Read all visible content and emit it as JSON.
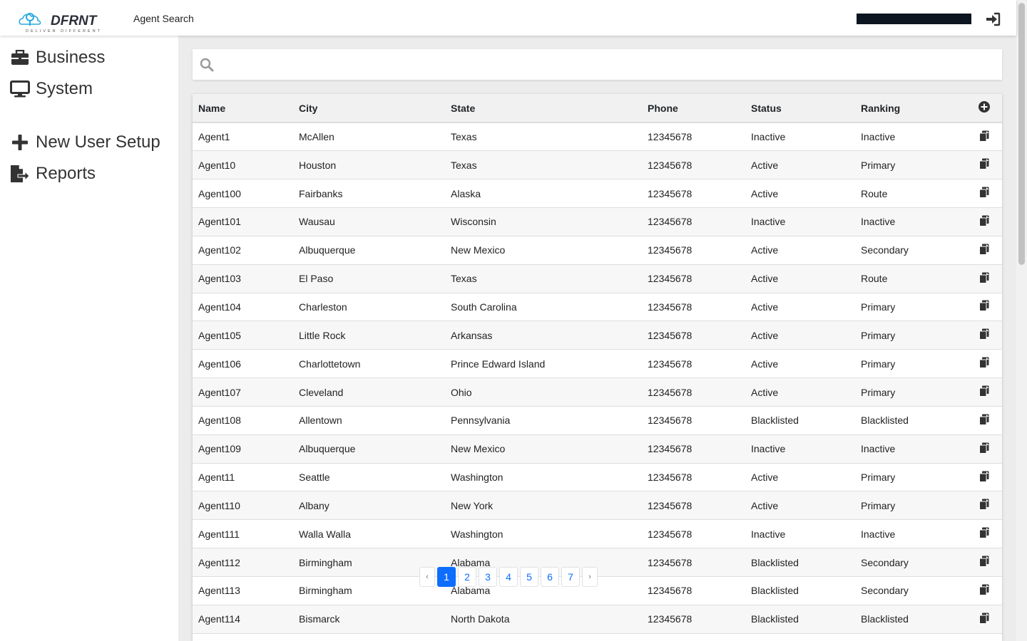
{
  "header": {
    "brand_name": "DFRNT",
    "brand_tagline": "DELIVER DIFFERENT",
    "app_title": "Agent Search"
  },
  "sidebar": {
    "items": [
      {
        "label": "Business",
        "icon": "briefcase-icon"
      },
      {
        "label": "System",
        "icon": "monitor-icon"
      },
      {
        "label": "New User Setup",
        "icon": "plus-icon"
      },
      {
        "label": "Reports",
        "icon": "file-export-icon"
      }
    ]
  },
  "search": {
    "placeholder": "",
    "value": ""
  },
  "table": {
    "headers": [
      "Name",
      "City",
      "State",
      "Phone",
      "Status",
      "Ranking"
    ],
    "rows": [
      [
        "Agent1",
        "McAllen",
        "Texas",
        "12345678",
        "Inactive",
        "Inactive"
      ],
      [
        "Agent10",
        "Houston",
        "Texas",
        "12345678",
        "Active",
        "Primary"
      ],
      [
        "Agent100",
        "Fairbanks",
        "Alaska",
        "12345678",
        "Active",
        "Route"
      ],
      [
        "Agent101",
        "Wausau",
        "Wisconsin",
        "12345678",
        "Inactive",
        "Inactive"
      ],
      [
        "Agent102",
        "Albuquerque",
        "New Mexico",
        "12345678",
        "Active",
        "Secondary"
      ],
      [
        "Agent103",
        "El Paso",
        "Texas",
        "12345678",
        "Active",
        "Route"
      ],
      [
        "Agent104",
        "Charleston",
        "South Carolina",
        "12345678",
        "Active",
        "Primary"
      ],
      [
        "Agent105",
        "Little Rock",
        "Arkansas",
        "12345678",
        "Active",
        "Primary"
      ],
      [
        "Agent106",
        "Charlottetown",
        "Prince Edward Island",
        "12345678",
        "Active",
        "Primary"
      ],
      [
        "Agent107",
        "Cleveland",
        "Ohio",
        "12345678",
        "Active",
        "Primary"
      ],
      [
        "Agent108",
        "Allentown",
        "Pennsylvania",
        "12345678",
        "Blacklisted",
        "Blacklisted"
      ],
      [
        "Agent109",
        "Albuquerque",
        "New Mexico",
        "12345678",
        "Inactive",
        "Inactive"
      ],
      [
        "Agent11",
        "Seattle",
        "Washington",
        "12345678",
        "Active",
        "Primary"
      ],
      [
        "Agent110",
        "Albany",
        "New York",
        "12345678",
        "Active",
        "Primary"
      ],
      [
        "Agent111",
        "Walla Walla",
        "Washington",
        "12345678",
        "Inactive",
        "Inactive"
      ],
      [
        "Agent112",
        "Birmingham",
        "Alabama",
        "12345678",
        "Blacklisted",
        "Secondary"
      ],
      [
        "Agent113",
        "Birmingham",
        "Alabama",
        "12345678",
        "Blacklisted",
        "Secondary"
      ],
      [
        "Agent114",
        "Bismarck",
        "North Dakota",
        "12345678",
        "Blacklisted",
        "Blacklisted"
      ]
    ]
  },
  "pagination": {
    "prev": "‹",
    "next": "›",
    "pages": [
      "1",
      "2",
      "3",
      "4",
      "5",
      "6",
      "7"
    ],
    "current": "1"
  },
  "colors": {
    "accent": "#0d6efd",
    "logo_blue": "#2aa8e0",
    "logo_dark": "#2b2f3a"
  }
}
